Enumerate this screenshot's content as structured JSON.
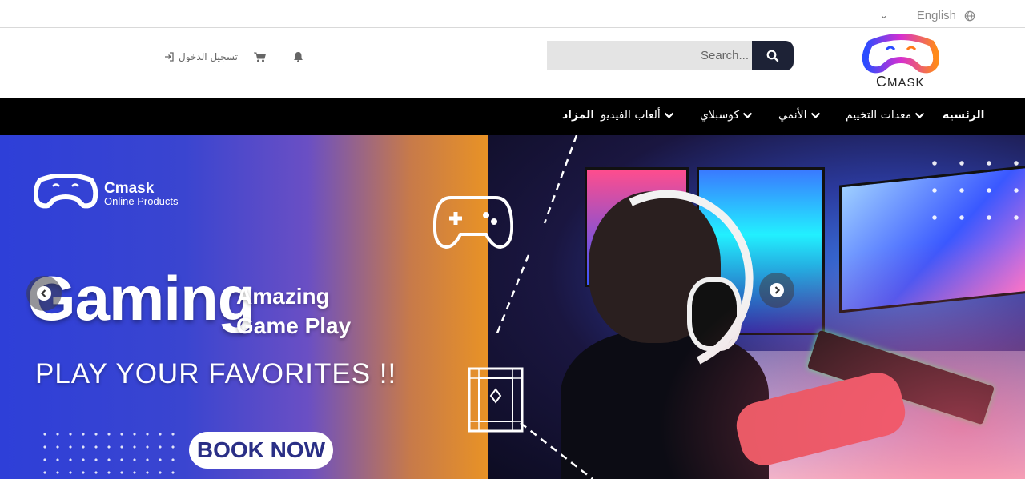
{
  "topbar": {
    "language": "English",
    "language_icon": "globe-icon",
    "dropdown_icon": "chevron-down-icon"
  },
  "header": {
    "logo_text": "MASK",
    "logo_initial": "C",
    "search": {
      "placeholder": "Search...",
      "button_icon": "search-icon",
      "button_color": "#1d2236"
    },
    "login_label": "تسجيل الدخول",
    "login_icon": "sign-in-icon",
    "cart_icon": "cart-icon",
    "bell_icon": "bell-icon"
  },
  "nav": {
    "items": [
      {
        "label": "الرئسيه",
        "dropdown": false
      },
      {
        "label": "معدات التخييم",
        "dropdown": true
      },
      {
        "label": "الأنمي",
        "dropdown": true
      },
      {
        "label": "كوسبلاي",
        "dropdown": true
      },
      {
        "label": "ألعاب الفيديو",
        "dropdown": true
      },
      {
        "label": "المزاد",
        "dropdown": false
      }
    ]
  },
  "hero": {
    "brand_name": "Cmask",
    "brand_sub": "Online Products",
    "headline": "Gaming",
    "tagline_1": "Amazing",
    "tagline_2": "Game Play",
    "subheadline": "PLAY YOUR FAVORITES !!",
    "cta": "BOOK NOW",
    "prev_icon": "chevron-left-icon",
    "next_icon": "chevron-right-icon",
    "accent_colors": {
      "blue": "#2e3fd8",
      "orange": "#f39a1a",
      "cta_text": "#2a2f86"
    }
  }
}
